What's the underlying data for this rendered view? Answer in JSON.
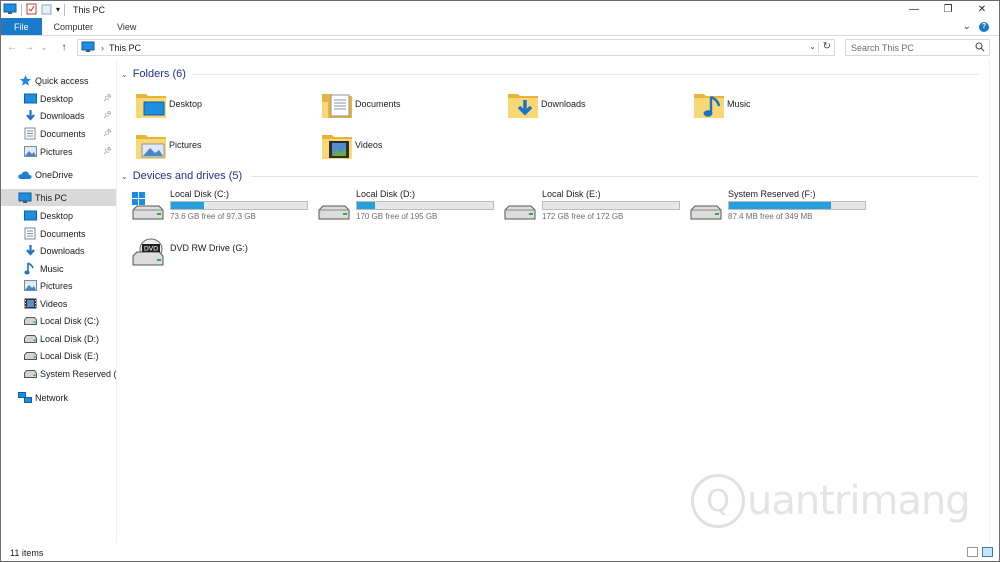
{
  "window": {
    "title": "This PC",
    "minimize": "—",
    "maximize": "❐",
    "close": "✕"
  },
  "ribbon": {
    "tabs": [
      "File",
      "Computer",
      "View"
    ],
    "expand": "⌄",
    "help": "?"
  },
  "address": {
    "back": "←",
    "forward": "→",
    "recent": "⌄",
    "up": "↑",
    "path": "This PC",
    "search_placeholder": "Search This PC"
  },
  "sidebar": {
    "quick_access": "Quick access",
    "quick_items": [
      {
        "label": "Desktop",
        "icon": "desktop-icon"
      },
      {
        "label": "Downloads",
        "icon": "downloads-icon"
      },
      {
        "label": "Documents",
        "icon": "documents-icon"
      },
      {
        "label": "Pictures",
        "icon": "pictures-icon"
      }
    ],
    "onedrive": "OneDrive",
    "this_pc": "This PC",
    "pc_items": [
      {
        "label": "Desktop",
        "icon": "desktop-icon"
      },
      {
        "label": "Documents",
        "icon": "documents-icon"
      },
      {
        "label": "Downloads",
        "icon": "downloads-icon"
      },
      {
        "label": "Music",
        "icon": "music-icon"
      },
      {
        "label": "Pictures",
        "icon": "pictures-icon"
      },
      {
        "label": "Videos",
        "icon": "videos-icon"
      },
      {
        "label": "Local Disk (C:)",
        "icon": "drive-icon"
      },
      {
        "label": "Local Disk (D:)",
        "icon": "drive-icon"
      },
      {
        "label": "Local Disk (E:)",
        "icon": "drive-icon"
      },
      {
        "label": "System Reserved (F:",
        "icon": "drive-icon"
      }
    ],
    "network": "Network"
  },
  "folders": {
    "header": "Folders (6)",
    "items": [
      "Desktop",
      "Documents",
      "Downloads",
      "Music",
      "Pictures",
      "Videos"
    ]
  },
  "drives": {
    "header": "Devices and drives (5)",
    "items": [
      {
        "name": "Local Disk (C:)",
        "free": "73.6 GB free of 97.3 GB",
        "used_fraction": 0.24
      },
      {
        "name": "Local Disk (D:)",
        "free": "170 GB free of 195 GB",
        "used_fraction": 0.13
      },
      {
        "name": "Local Disk (E:)",
        "free": "172 GB free of 172 GB",
        "used_fraction": 0.0
      },
      {
        "name": "System Reserved (F:)",
        "free": "87.4 MB free of 349 MB",
        "used_fraction": 0.75
      }
    ],
    "dvd": {
      "name": "DVD RW Drive (G:)",
      "badge": "DVD"
    }
  },
  "status": {
    "count": "11 items"
  },
  "watermark": {
    "text": "uantrimang",
    "q": "Q"
  },
  "colors": {
    "accent": "#1979ca",
    "bar_fill": "#26a0da",
    "group_header": "#1e3287",
    "folder": "#f5c84c"
  }
}
